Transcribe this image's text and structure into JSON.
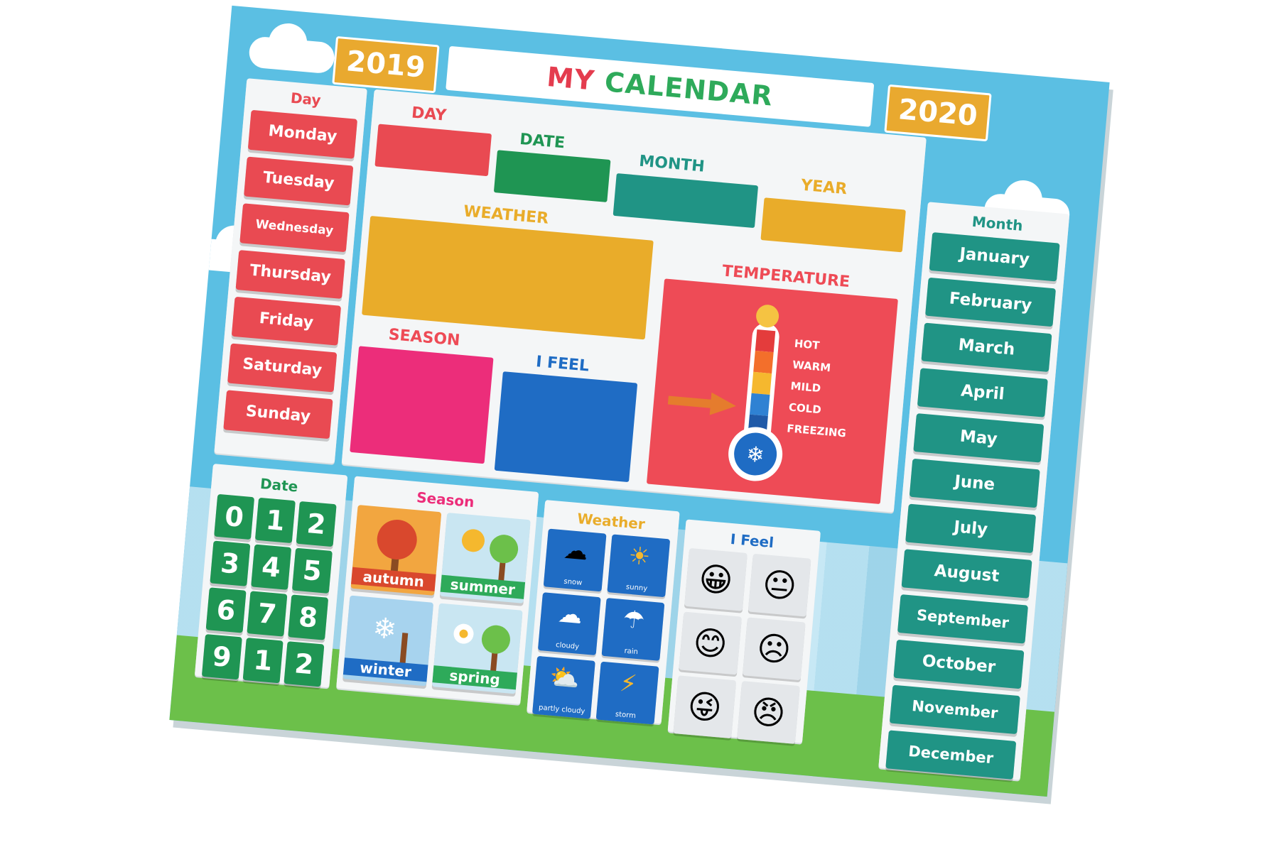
{
  "years": {
    "left": "2019",
    "right": "2020"
  },
  "title": {
    "parts": [
      "MY",
      "CALENDAR"
    ]
  },
  "day_panel": {
    "title": "Day",
    "items": [
      "Monday",
      "Tuesday",
      "Wednesday",
      "Thursday",
      "Friday",
      "Saturday",
      "Sunday"
    ]
  },
  "month_panel": {
    "title": "Month",
    "items": [
      "January",
      "February",
      "March",
      "April",
      "May",
      "June",
      "July",
      "August",
      "September",
      "October",
      "November",
      "December"
    ]
  },
  "center": {
    "day_label": "DAY",
    "date_label": "DATE",
    "month_label": "MONTH",
    "year_label": "YEAR",
    "weather_label": "WEATHER",
    "temperature_label": "TEMPERATURE",
    "season_label": "SEASON",
    "feel_label": "I FEEL"
  },
  "thermometer": {
    "levels": [
      "HOT",
      "WARM",
      "MILD",
      "COLD",
      "FREEZING"
    ]
  },
  "date_panel": {
    "title": "Date",
    "digits": [
      "0",
      "1",
      "2",
      "3",
      "4",
      "5",
      "6",
      "7",
      "8",
      "9",
      "1",
      "2"
    ]
  },
  "season_panel": {
    "title": "Season",
    "cards": [
      "autumn",
      "summer",
      "winter",
      "spring"
    ]
  },
  "weather_panel": {
    "title": "Weather",
    "cards": [
      "snow",
      "sunny",
      "cloudy",
      "rain",
      "partly cloudy",
      "storm"
    ]
  },
  "feel_panel": {
    "title": "I Feel"
  },
  "colors": {
    "board": "#5bbfe3",
    "red": "#e94a52",
    "green": "#1f9553",
    "teal": "#209485",
    "yellow": "#e9ac2a",
    "pink": "#ec2d7a",
    "blue": "#1f6cc4",
    "temp_red": "#ee4b56"
  }
}
